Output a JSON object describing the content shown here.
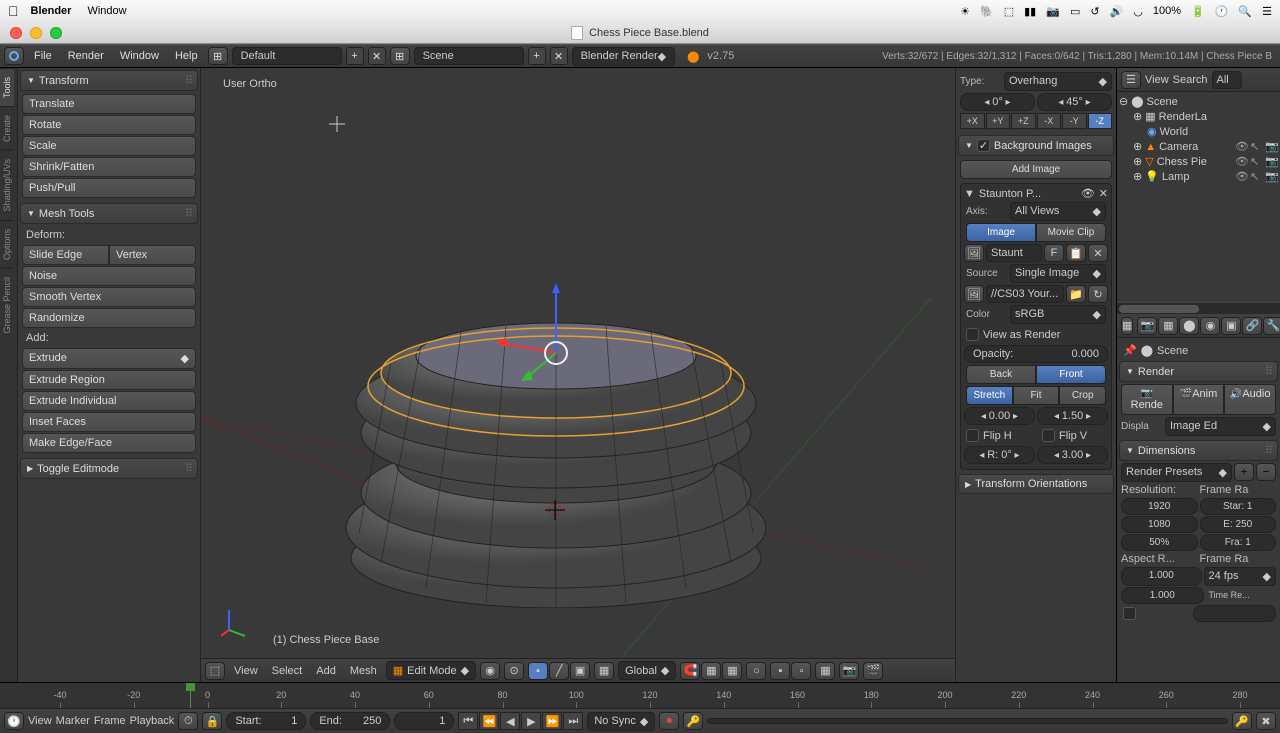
{
  "mac": {
    "app": "Blender",
    "menu2": "Window",
    "battery": "100%",
    "icons": [
      "sun",
      "evernote",
      "dropbox",
      "bars",
      "camera",
      "screen",
      "clock-ccw",
      "volume",
      "wifi",
      "search",
      "list"
    ]
  },
  "titlebar": {
    "filename": "Chess Piece Base.blend"
  },
  "info": {
    "menus": [
      "File",
      "Render",
      "Window",
      "Help"
    ],
    "layout": "Default",
    "scene": "Scene",
    "engine": "Blender Render",
    "version": "v2.75",
    "stats": "Verts:32/672 | Edges:32/1,312 | Faces:0/642 | Tris:1,280 | Mem:10.14M | Chess Piece B"
  },
  "tool_tabs": [
    "Tools",
    "Create",
    "Shading/UVs",
    "Options",
    "Grease Pencil"
  ],
  "transform": {
    "title": "Transform",
    "buttons": [
      "Translate",
      "Rotate",
      "Scale",
      "Shrink/Fatten",
      "Push/Pull"
    ]
  },
  "mesh_tools": {
    "title": "Mesh Tools",
    "deform_label": "Deform:",
    "slide_edge": "Slide Edge",
    "vertex": "Vertex",
    "buttons": [
      "Noise",
      "Smooth Vertex",
      "Randomize"
    ],
    "add_label": "Add:",
    "extrude": "Extrude",
    "add_buttons": [
      "Extrude Region",
      "Extrude Individual",
      "Inset Faces",
      "Make Edge/Face"
    ]
  },
  "toggle_edit": {
    "title": "Toggle Editmode"
  },
  "viewport": {
    "view_label": "User Ortho",
    "object_label": "(1) Chess Piece Base",
    "menus": [
      "View",
      "Select",
      "Add",
      "Mesh"
    ],
    "mode": "Edit Mode",
    "orientation": "Global"
  },
  "npanel": {
    "type_label": "Type:",
    "type_value": "Overhang",
    "angle1": "0°",
    "angle2": "45°",
    "axes": [
      "+X",
      "+Y",
      "+Z",
      "-X",
      "-Y",
      "-Z"
    ],
    "bg_title": "Background Images",
    "add_image": "Add Image",
    "img_name": "Staunton P...",
    "axis_label": "Axis:",
    "axis_value": "All Views",
    "image_btn": "Image",
    "movie_btn": "Movie Clip",
    "img_file": "Staunt",
    "f_btn": "F",
    "source_label": "Source",
    "source_value": "Single Image",
    "img_path": "//CS03 Your...",
    "color_label": "Color",
    "color_value": "sRGB",
    "view_render": "View as Render",
    "opacity_label": "Opacity:",
    "opacity_value": "0.000",
    "back": "Back",
    "front": "Front",
    "stretch": "Stretch",
    "fit": "Fit",
    "crop": "Crop",
    "x_val": "0.00",
    "y_val": "1.50",
    "flip_h": "Flip H",
    "flip_v": "Flip V",
    "rot": "R: 0°",
    "size": "3.00",
    "trans_orient": "Transform Orientations"
  },
  "outliner": {
    "menus": [
      "View",
      "Search"
    ],
    "all": "All ",
    "scene": "Scene",
    "items": [
      {
        "name": "RenderLa",
        "indent": 1,
        "icon": "layers"
      },
      {
        "name": "World",
        "indent": 1,
        "icon": "world"
      },
      {
        "name": "Camera",
        "indent": 1,
        "icon": "camera",
        "toggles": true
      },
      {
        "name": "Chess Pie",
        "indent": 1,
        "icon": "mesh",
        "toggles": true,
        "sel": true
      },
      {
        "name": "Lamp",
        "indent": 1,
        "icon": "lamp",
        "toggles": true
      }
    ]
  },
  "props": {
    "scene_crumb": "Scene",
    "render_title": "Render",
    "render_btns": [
      "Rende",
      "Anim",
      "Audio"
    ],
    "display_label": "Displa",
    "display_value": "Image Ed",
    "dim_title": "Dimensions",
    "presets": "Render Presets",
    "res_label": "Resolution:",
    "frame_label": "Frame Ra",
    "res_x": "1920",
    "res_y": "1080",
    "res_pct": "50%",
    "start": "Star: 1",
    "end": "E: 250",
    "frame": "Fra: 1",
    "aspect_label": "Aspect R...",
    "framerate_label": "Frame Ra",
    "asp_x": "1.000",
    "asp_y": "1.000",
    "fps": "24 fps",
    "time_remap": "Time Re..."
  },
  "timeline": {
    "ticks": [
      -40,
      -20,
      0,
      20,
      40,
      60,
      80,
      100,
      120,
      140,
      160,
      180,
      200,
      220,
      240,
      260,
      280
    ],
    "current": 1,
    "menus": [
      "View",
      "Marker",
      "Frame",
      "Playback"
    ],
    "start_label": "Start:",
    "start_val": "1",
    "end_label": "End:",
    "end_val": "250",
    "frame_val": "1",
    "sync": "No Sync"
  }
}
